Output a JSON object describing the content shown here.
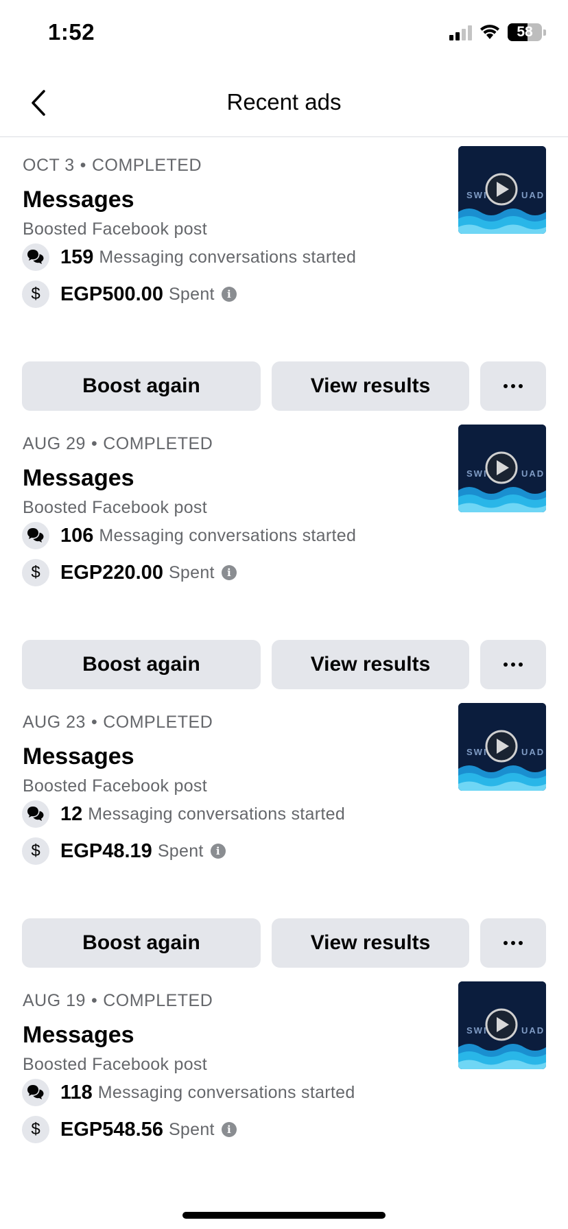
{
  "status_bar": {
    "time": "1:52",
    "battery": "58",
    "battery_level": 0.58
  },
  "nav": {
    "title": "Recent ads"
  },
  "actions": {
    "boost_label": "Boost again",
    "view_label": "View results"
  },
  "ads": [
    {
      "date": "OCT 3",
      "status": "COMPLETED",
      "title": "Messages",
      "subtitle": "Boosted Facebook post",
      "conversations": "159",
      "conversations_label": "Messaging conversations started",
      "spent": "EGP500.00",
      "spent_label": "Spent"
    },
    {
      "date": "AUG 29",
      "status": "COMPLETED",
      "title": "Messages",
      "subtitle": "Boosted Facebook post",
      "conversations": "106",
      "conversations_label": "Messaging conversations started",
      "spent": "EGP220.00",
      "spent_label": "Spent"
    },
    {
      "date": "AUG 23",
      "status": "COMPLETED",
      "title": "Messages",
      "subtitle": "Boosted Facebook post",
      "conversations": "12",
      "conversations_label": "Messaging conversations started",
      "spent": "EGP48.19",
      "spent_label": "Spent"
    },
    {
      "date": "AUG 19",
      "status": "COMPLETED",
      "title": "Messages",
      "subtitle": "Boosted Facebook post",
      "conversations": "118",
      "conversations_label": "Messaging conversations started",
      "spent": "EGP548.56",
      "spent_label": "Spent"
    }
  ],
  "icons": {
    "back": "chevron-left-icon",
    "conversations": "chat-bubbles-icon",
    "spent": "dollar-icon",
    "info": "info-icon",
    "more": "more-dots-icon",
    "play": "play-icon"
  },
  "colors": {
    "button_bg": "#e4e6eb",
    "secondary_text": "#65676b",
    "thumb_bg": "#0b1d3d",
    "wave": "#29b6e8"
  }
}
